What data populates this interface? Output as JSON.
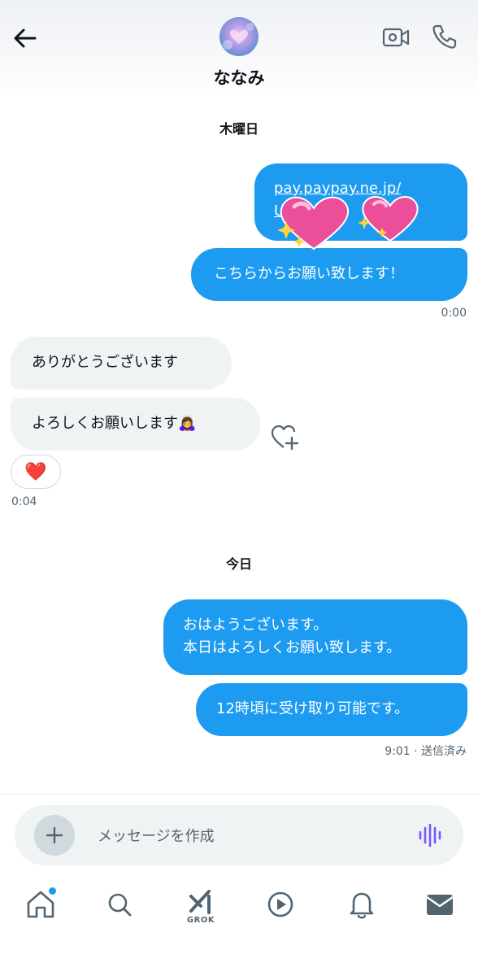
{
  "header": {
    "name": "ななみ",
    "back_icon": "arrow-left-icon",
    "video_icon": "video-camera-icon",
    "phone_icon": "phone-icon"
  },
  "thread": {
    "date_1": "木曜日",
    "link_line_1": "pay.paypay.ne.jp/",
    "link_line_2": "U                    uG...",
    "out_msg_1": "こちらからお願い致します！",
    "out_time_1": "0:00",
    "in_msg_1": "ありがとうございます",
    "in_msg_2": "よろしくお願いします🙇‍♀️",
    "reaction_emoji": "❤️",
    "in_time_1": "0:04",
    "date_2": "今日",
    "out_msg_2_line_1": "おはようございます。",
    "out_msg_2_line_2": "本日はよろしくお願い致します。",
    "out_msg_3": "12時頃に受け取り可能です。",
    "out_time_2": "9:01 · 送信済み"
  },
  "composer": {
    "placeholder": "メッセージを作成"
  },
  "nav": {
    "grok_label": "GROK"
  },
  "colors": {
    "accent": "#1d9bf0",
    "incoming_bubble": "#eff3f4",
    "grok_voice": "#7856ff",
    "text_secondary": "#536471"
  }
}
